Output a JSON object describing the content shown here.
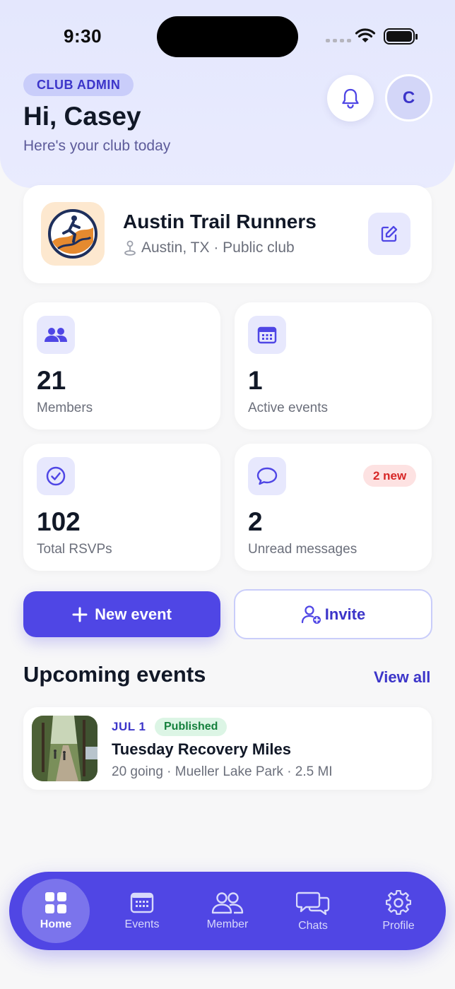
{
  "status_bar": {
    "time": "9:30"
  },
  "header": {
    "role_badge": "CLUB ADMIN",
    "greeting": "Hi, Casey",
    "subtitle": "Here's your club today",
    "avatar_initial": "C"
  },
  "club": {
    "name": "Austin Trail Runners",
    "meta": "Austin, TX · Public club"
  },
  "stats": [
    {
      "value": "21",
      "label": "Members",
      "icon": "members-icon"
    },
    {
      "value": "1",
      "label": "Active events",
      "icon": "calendar-icon"
    },
    {
      "value": "102",
      "label": "Total RSVPs",
      "icon": "check-circle-icon"
    },
    {
      "value": "2",
      "label": "Unread messages",
      "icon": "chat-bubble-icon",
      "badge": "2 new"
    }
  ],
  "actions": {
    "new_event": "New event",
    "invite": "Invite"
  },
  "upcoming": {
    "title": "Upcoming events",
    "view_all": "View all",
    "events": [
      {
        "date": "JUL 1",
        "status": "Published",
        "title": "Tuesday Recovery Miles",
        "meta": "20 going · Mueller Lake Park · 2.5 MI"
      }
    ]
  },
  "tabbar": {
    "items": [
      {
        "label": "Home",
        "icon": "grid-icon",
        "active": true
      },
      {
        "label": "Events",
        "icon": "calendar-icon"
      },
      {
        "label": "Member",
        "icon": "members-icon"
      },
      {
        "label": "Chats",
        "icon": "chats-icon"
      },
      {
        "label": "Profile",
        "icon": "gear-icon"
      }
    ]
  },
  "colors": {
    "accent": "#4f46e5",
    "accent_light": "#e7e8fd",
    "header_bg": "#e6e9fe",
    "badge_red": "#d72626",
    "badge_green": "#15803d"
  }
}
